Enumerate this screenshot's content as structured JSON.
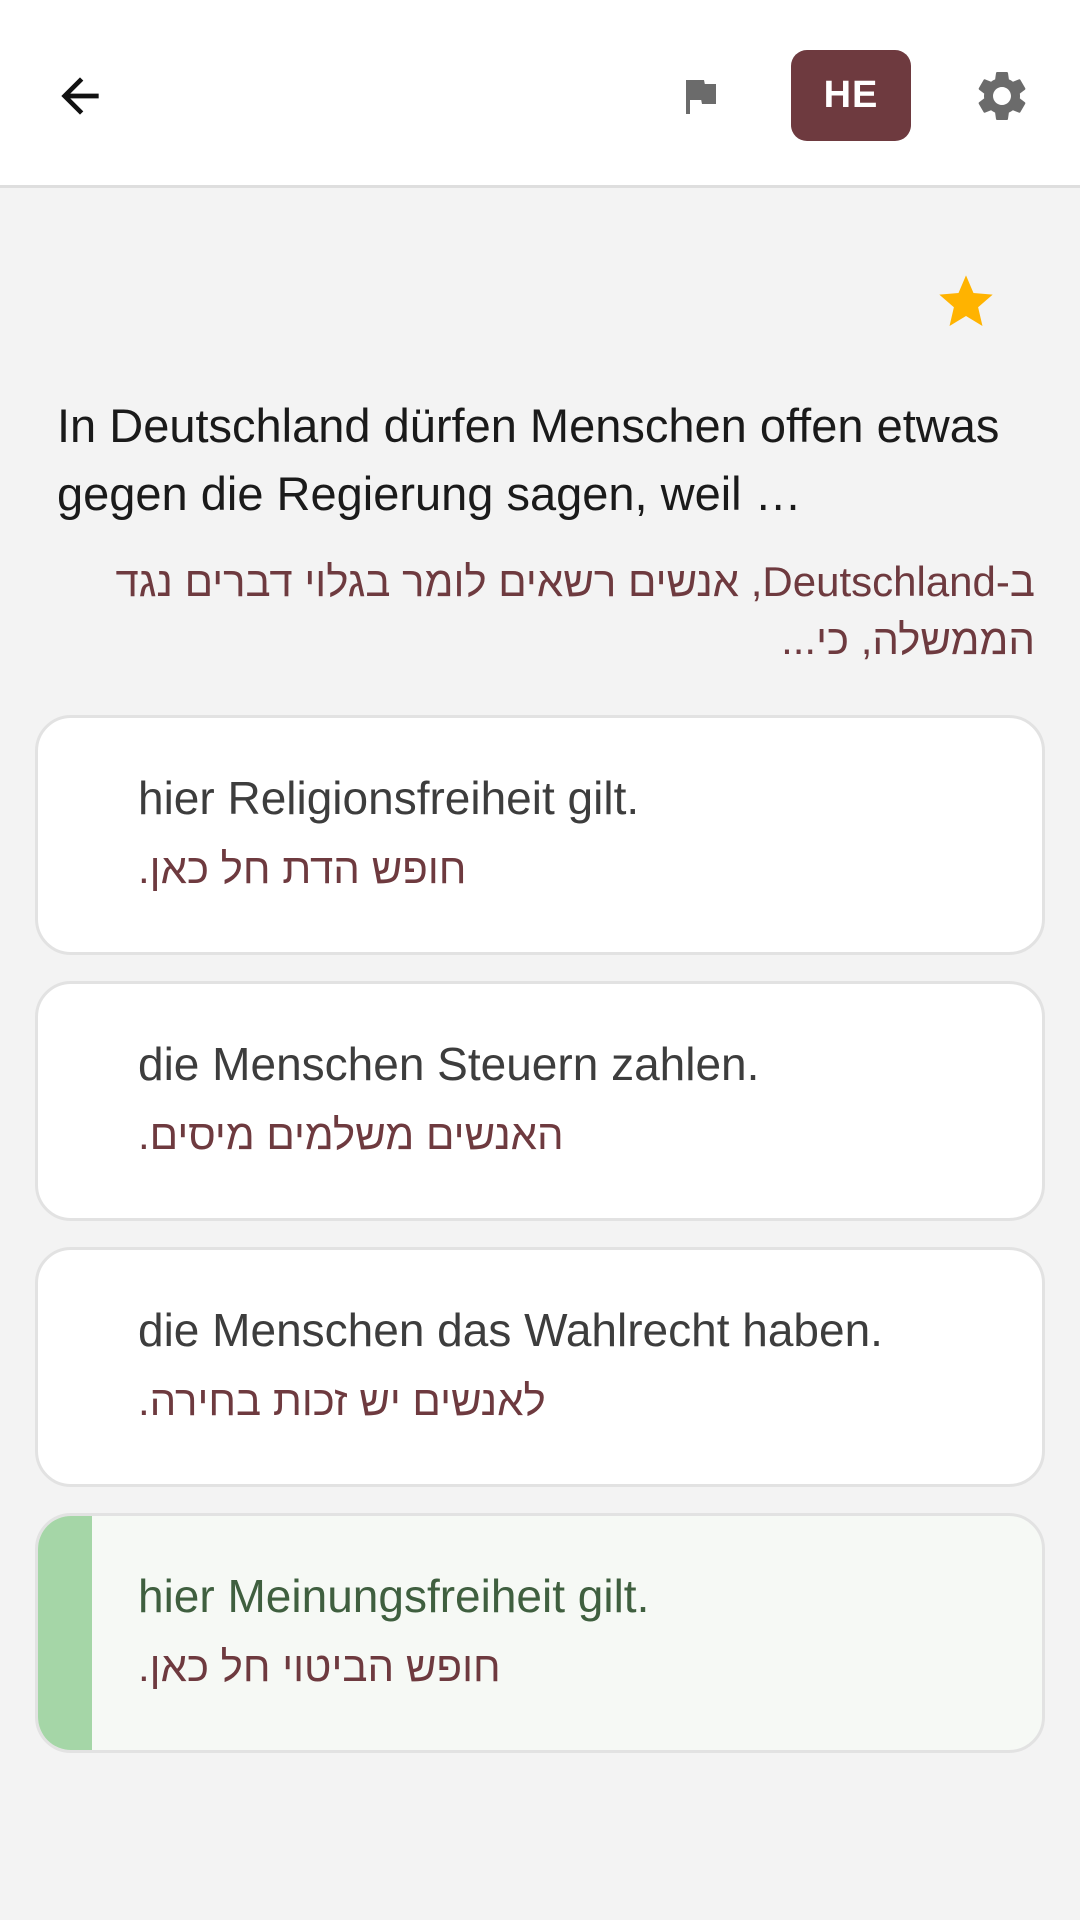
{
  "header": {
    "language_label": "HE"
  },
  "question": {
    "text": "In Deutschland dürfen Menschen offen etwas gegen die Regierung sagen, weil …",
    "translation": "ב-Deutschland, אנשים רשאים לומר בגלוי דברים נגד הממשלה, כי..."
  },
  "answers": [
    {
      "text": "hier Religionsfreiheit gilt.",
      "translation": "חופש הדת חל כאן."
    },
    {
      "text": "die Menschen Steuern zahlen.",
      "translation": "האנשים משלמים מיסים."
    },
    {
      "text": "die Menschen das Wahlrecht haben.",
      "translation": "לאנשים יש זכות בחירה."
    },
    {
      "text": "hier Meinungsfreiheit gilt.",
      "translation": "חופש הביטוי חל כאן."
    }
  ],
  "correct_answer_index": 3,
  "colors": {
    "accent": "#6e3a3f",
    "star": "#ffb300",
    "correct_bar": "#a5d6a7"
  }
}
